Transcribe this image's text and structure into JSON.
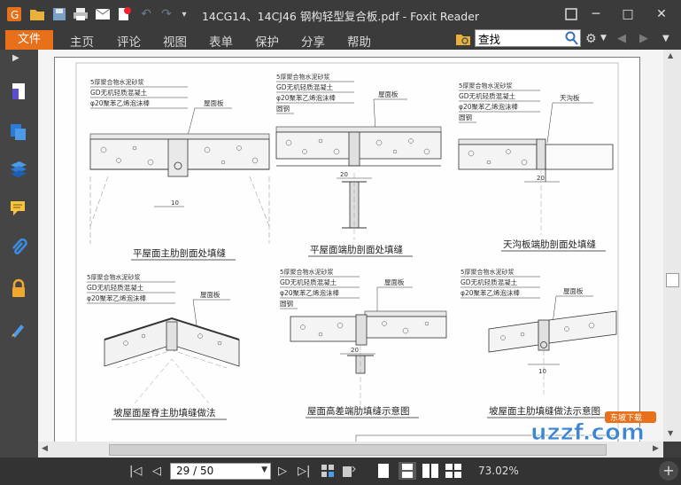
{
  "window": {
    "title": "14CG14、14CJ46 钢构轻型复合板.pdf - Foxit Reader"
  },
  "ribbon": {
    "file_tab": "文件",
    "tabs": [
      "主页",
      "评论",
      "视图",
      "表单",
      "保护",
      "分享",
      "帮助"
    ]
  },
  "search": {
    "value": "查找"
  },
  "document": {
    "details": [
      {
        "title": "平屋面主肋剖面处填缝",
        "labels": [
          "5厚聚合物水泥砂浆",
          "GD无机轻质混凝土",
          "φ20聚苯乙烯泡沫棒"
        ],
        "panel": "屋面板",
        "dims": [
          "10"
        ]
      },
      {
        "title": "平屋面端肋剖面处填缝",
        "labels": [
          "5厚聚合物水泥砂浆",
          "GD无机轻质混凝土",
          "φ20聚苯乙烯泡沫棒",
          "圆钢"
        ],
        "panel": "屋面板",
        "dims": [
          "20"
        ]
      },
      {
        "title": "天沟板端肋剖面处填缝",
        "labels": [
          "5厚聚合物水泥砂浆",
          "GD无机轻质混凝土",
          "φ20聚苯乙烯泡沫棒",
          "圆钢"
        ],
        "panel": "天沟板",
        "dims": [
          "20"
        ]
      },
      {
        "title": "坡屋面屋脊主肋填缝做法",
        "labels": [
          "5厚聚合物水泥砂浆",
          "GD无机轻质混凝土",
          "φ20聚苯乙烯泡沫棒"
        ],
        "panel": "屋面板",
        "dims": []
      },
      {
        "title": "屋面高差端肋填缝示意图",
        "labels": [
          "5厚聚合物水泥砂浆",
          "GD无机轻质混凝土",
          "φ20聚苯乙烯泡沫棒",
          "圆钢"
        ],
        "panel": "屋面板",
        "dims": [
          "20"
        ]
      },
      {
        "title": "坡屋面主肋填缝做法示意图",
        "labels": [
          "5厚聚合物水泥砂浆",
          "GD无机轻质混凝土",
          "φ20聚苯乙烯泡沫棒"
        ],
        "panel": "屋面板",
        "dims": [
          "10"
        ]
      }
    ]
  },
  "navigation": {
    "page_value": "29 / 50",
    "zoom": "73.02%"
  },
  "watermark": {
    "text": "uzzf.com",
    "badge": "东坡下载"
  },
  "colors": {
    "accent": "#e8701a",
    "chrome": "#3b3b3b",
    "sidebar": "#454545"
  }
}
